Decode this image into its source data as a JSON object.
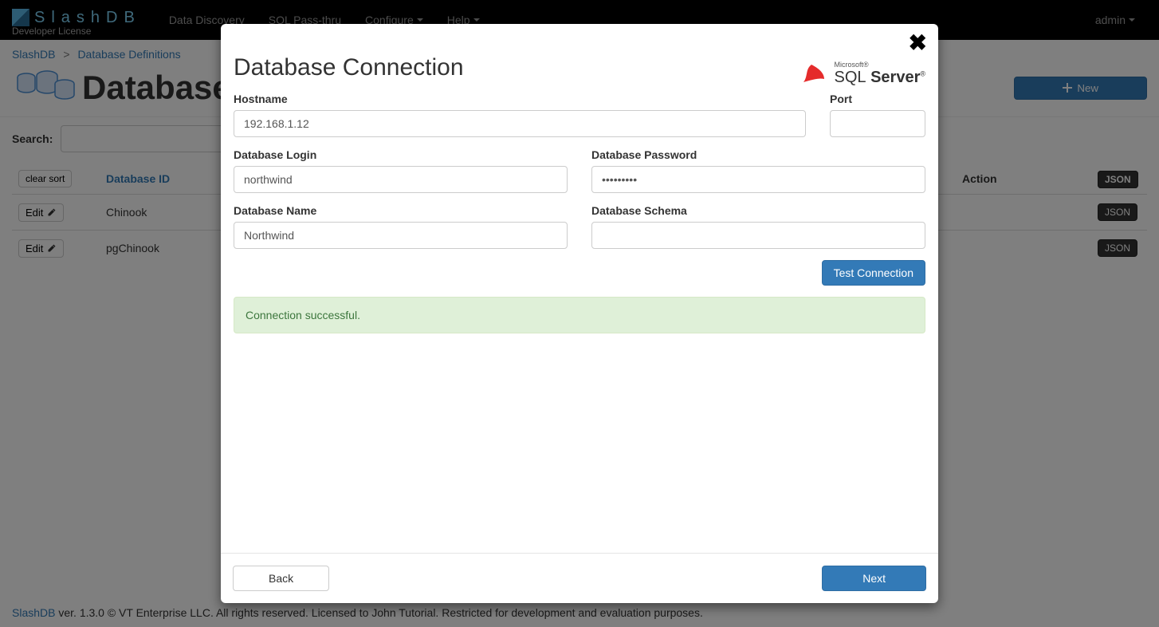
{
  "navbar": {
    "brand": "SlashDB",
    "license": "Developer License",
    "items": [
      "Data Discovery",
      "SQL Pass-thru",
      "Configure",
      "Help"
    ],
    "user": "admin"
  },
  "breadcrumb": {
    "root": "SlashDB",
    "current": "Database Definitions"
  },
  "page": {
    "title": "Database",
    "new_button": "New",
    "search_label": "Search:"
  },
  "table": {
    "clear_sort": "clear sort",
    "headers": {
      "dbid": "Database ID",
      "action": "Action",
      "json": "JSON"
    },
    "edit_label": "Edit",
    "json_label": "JSON",
    "rows": [
      {
        "dbid": "Chinook"
      },
      {
        "dbid": "pgChinook"
      }
    ]
  },
  "modal": {
    "title": "Database Connection",
    "sqlserver_ms": "Microsoft®",
    "sqlserver_sql": "SQL",
    "sqlserver_server": "Server",
    "labels": {
      "hostname": "Hostname",
      "port": "Port",
      "dblogin": "Database Login",
      "dbpassword": "Database Password",
      "dbname": "Database Name",
      "dbschema": "Database Schema"
    },
    "values": {
      "hostname": "192.168.1.12",
      "port": "",
      "dblogin": "northwind",
      "dbpassword": "•••••••••",
      "dbname": "Northwind",
      "dbschema": ""
    },
    "test_connection": "Test Connection",
    "alert": "Connection successful.",
    "back": "Back",
    "next": "Next"
  },
  "footer": {
    "brand": "SlashDB",
    "rest": " ver. 1.3.0 © VT Enterprise LLC. All rights reserved. Licensed to John Tutorial. Restricted for development and evaluation purposes."
  }
}
